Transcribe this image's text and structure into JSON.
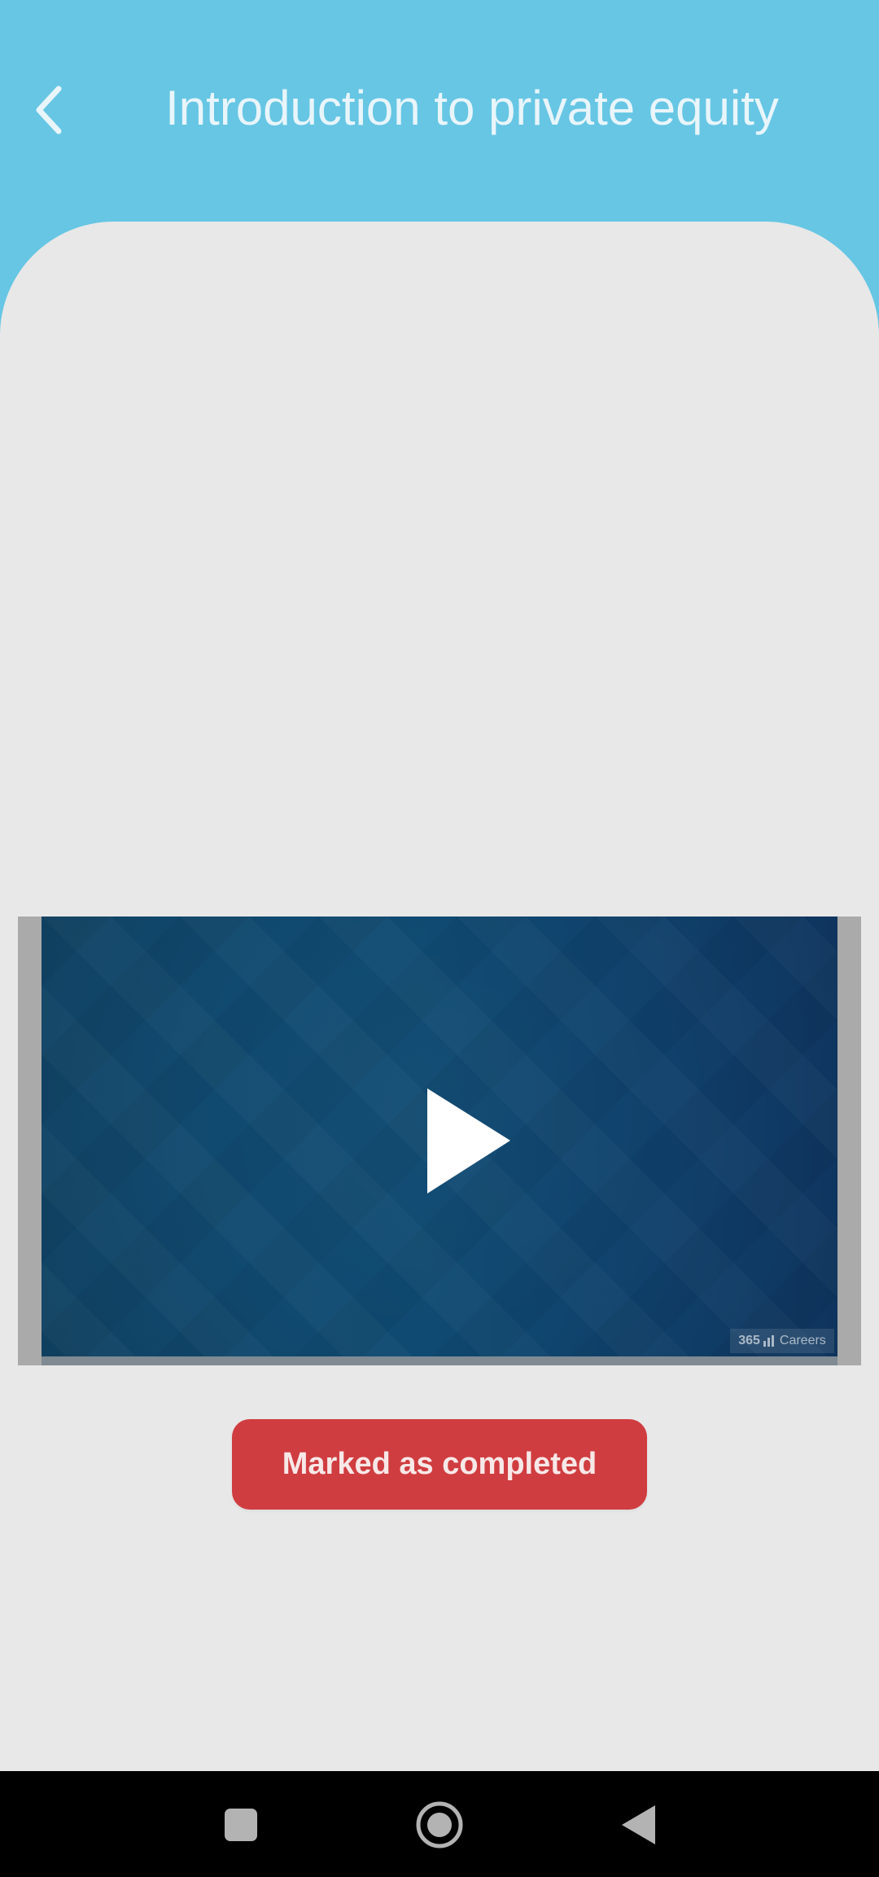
{
  "header": {
    "title": "Introduction to private equity",
    "back_icon": "chevron-left-icon"
  },
  "video": {
    "play_icon": "play-icon",
    "brand": {
      "number": "365",
      "name": "Careers"
    }
  },
  "actions": {
    "completed_label": "Marked as completed",
    "fab_icon": "play-icon"
  },
  "navigation": {
    "buttons": [
      "square-nav-icon",
      "home-circle-icon",
      "back-triangle-icon"
    ]
  },
  "colors": {
    "header_blue": "#66c6e4",
    "background_gray": "#e8e8e8",
    "video_blue": "#0f4a72",
    "accent_red": "#d03d40",
    "nav_black": "#000000"
  }
}
